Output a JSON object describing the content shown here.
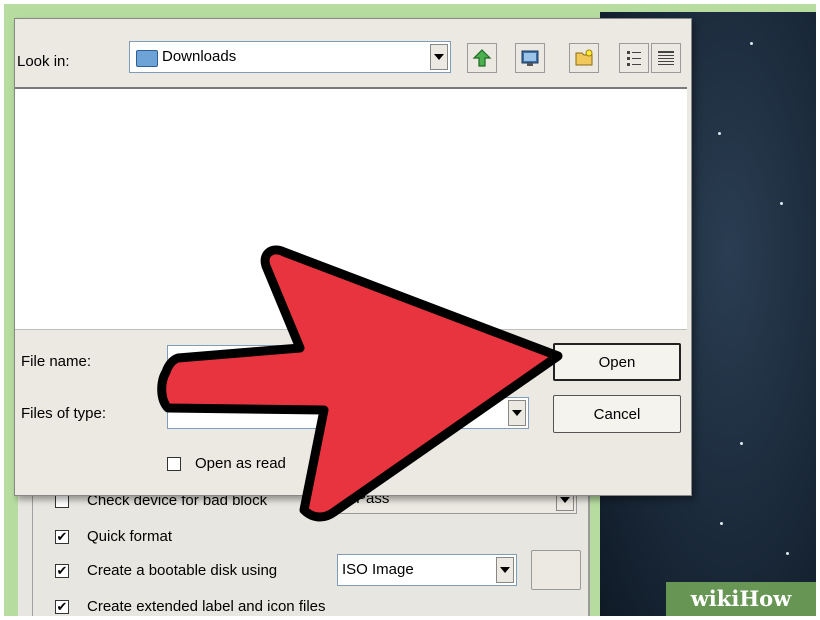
{
  "dialog": {
    "look_in_label": "Look in:",
    "look_in_value": "Downloads",
    "toolbar_icons": [
      "up-folder-icon",
      "desktop-icon",
      "new-folder-icon",
      "list-view-icon",
      "details-view-icon"
    ],
    "file_name_label": "File name:",
    "file_name_value": "",
    "files_of_type_label": "Files of type:",
    "open_button": "Open",
    "cancel_button": "Cancel",
    "open_readonly_label": "Open as read",
    "open_readonly_checked": false
  },
  "rufus": {
    "bad_blocks_label": "Check device for bad block",
    "bad_blocks_checked": false,
    "passes_value": "Pass",
    "quick_format_label": "Quick format",
    "quick_format_checked": true,
    "bootable_label": "Create a bootable disk using",
    "bootable_checked": true,
    "bootable_type": "ISO Image",
    "extended_label": "Create extended label and icon files",
    "extended_checked": true
  },
  "watermark": "wikiHow",
  "colors": {
    "arrow_fill": "#e8343f",
    "frame_green": "#b6dca0",
    "desktop_blue": "#1b2a3b"
  }
}
